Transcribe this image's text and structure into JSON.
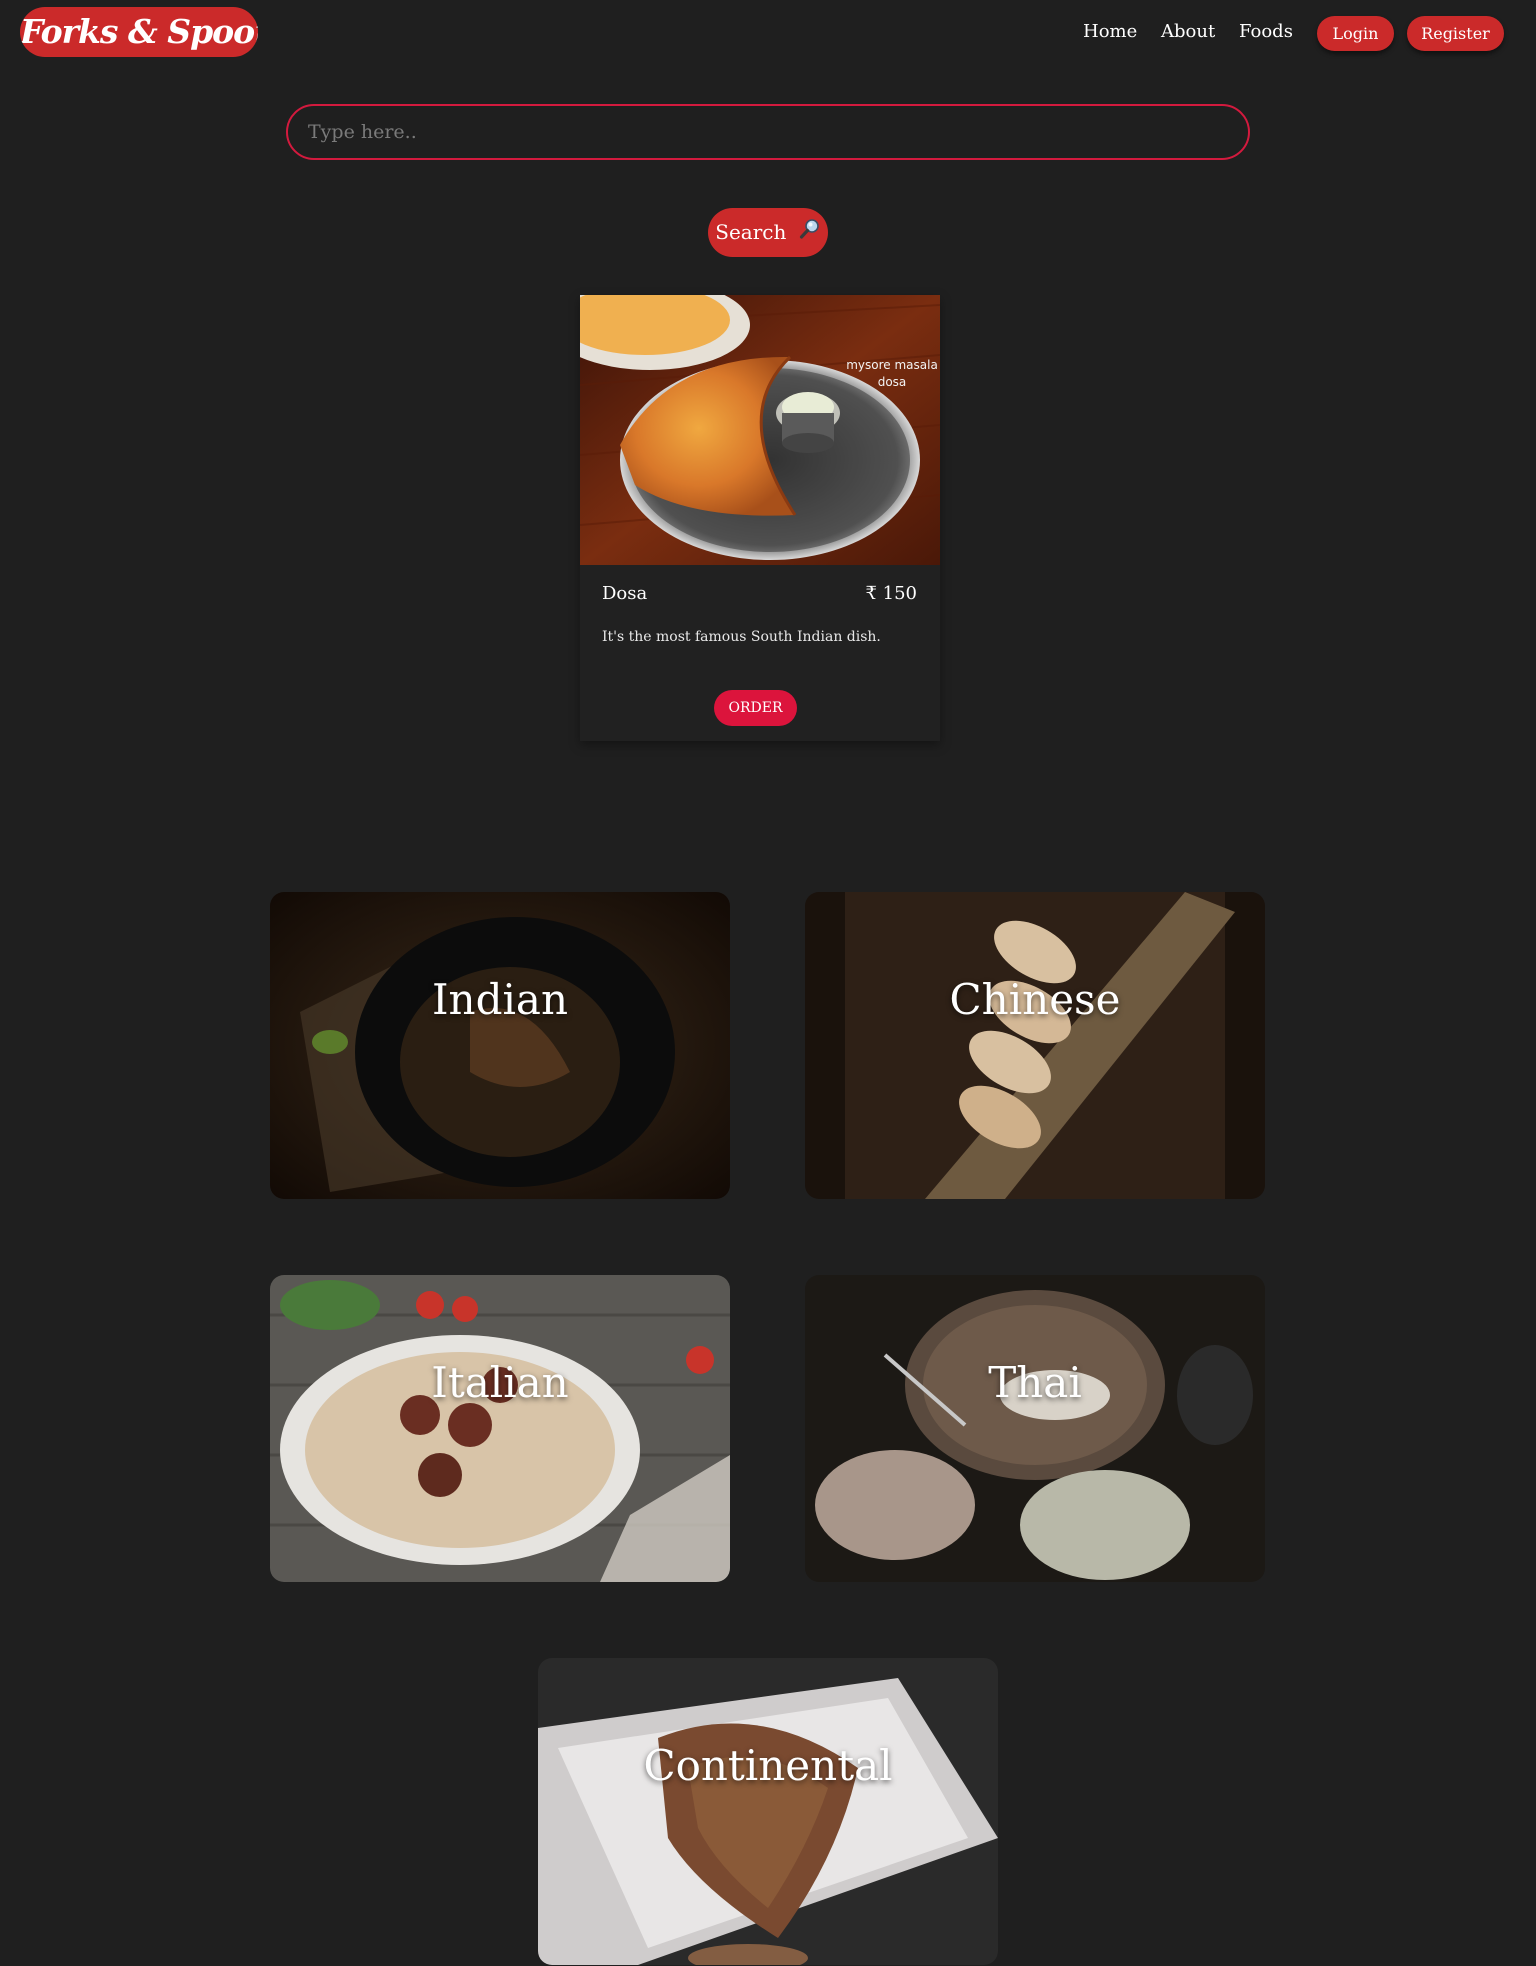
{
  "navbar": {
    "brand": "Forks & Spoons",
    "links": [
      "Home",
      "About",
      "Foods"
    ],
    "login_label": "Login",
    "register_label": "Register"
  },
  "search": {
    "placeholder": "Type here..",
    "value": "",
    "button_label": "Search",
    "button_icon": "magnifier-icon"
  },
  "food_card": {
    "image_caption_line1": "mysore masala",
    "image_caption_line2": "dosa",
    "name": "Dosa",
    "price": "₹ 150",
    "description": "It's the most famous South Indian dish.",
    "order_label": "ORDER"
  },
  "cuisines": [
    "Indian",
    "Chinese",
    "Italian",
    "Thai",
    "Continental"
  ],
  "colors": {
    "background": "#1f1f1f",
    "accent_red": "#cb2a2a",
    "crimson": "#dc143c"
  }
}
